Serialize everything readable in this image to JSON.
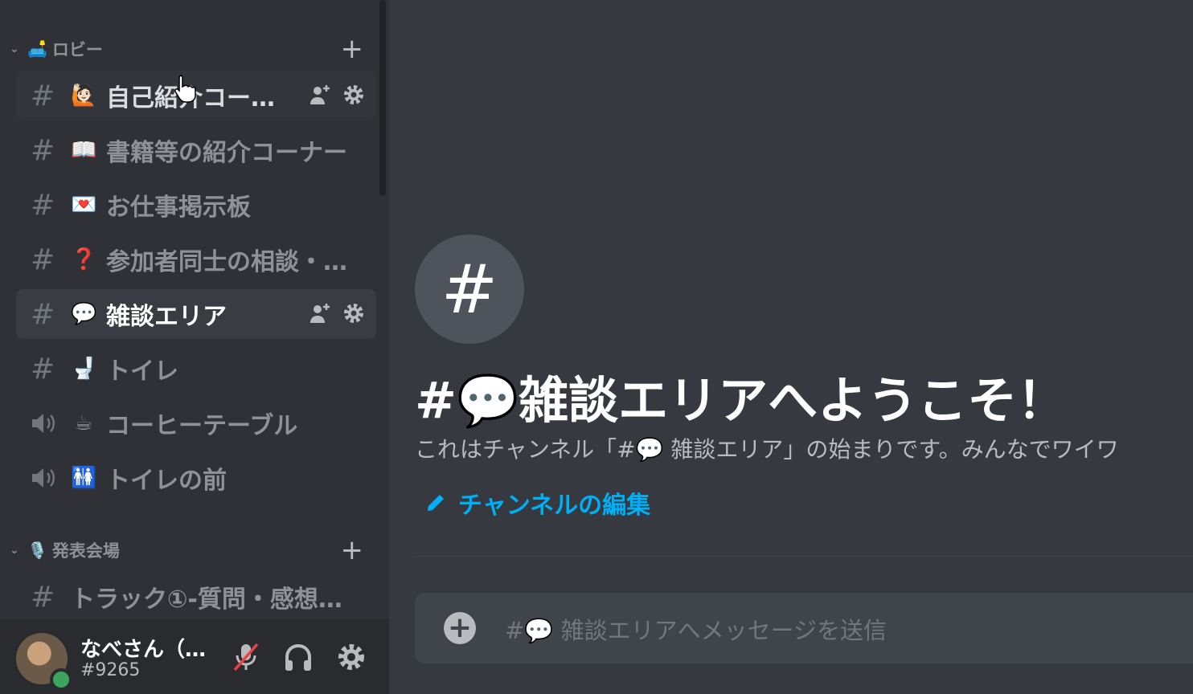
{
  "sidebar": {
    "categories": [
      {
        "emoji": "🛋️",
        "label": "ロビー"
      },
      {
        "emoji": "🎙️",
        "label": "発表会場"
      }
    ],
    "channels": [
      {
        "emoji": "🙋🏻",
        "label": "自己紹介コー…"
      },
      {
        "emoji": "📖",
        "label": "書籍等の紹介コーナー"
      },
      {
        "emoji": "💌",
        "label": "お仕事掲示板"
      },
      {
        "emoji": "❓",
        "label": "参加者同士の相談・…"
      },
      {
        "emoji": "💬",
        "label": "雑談エリア"
      },
      {
        "emoji": "🚽",
        "label": "トイレ"
      },
      {
        "emoji": "☕",
        "label": "コーヒーテーブル"
      },
      {
        "emoji": "🚻",
        "label": "トイレの前"
      },
      {
        "emoji": "",
        "label": "トラック①-質問・感想…"
      }
    ],
    "selected_channel": "雑談エリア"
  },
  "user_panel": {
    "username": "なべさん（…",
    "discriminator": "#9265",
    "status": "online"
  },
  "main": {
    "hash_symbol": "#",
    "welcome_title": "#💬雑談エリアへようこそ！",
    "welcome_description": "これはチャンネル「#💬 雑談エリア」の始まりです。みんなでワイワ",
    "edit_channel_label": "チャンネルの編集",
    "composer_placeholder": "#💬 雑談エリアへメッセージを送信"
  },
  "colors": {
    "sidebar_bg": "#2f3136",
    "main_bg": "#36393f",
    "link": "#00aff4",
    "online": "#3ba55d",
    "muted_red": "#ed4245"
  }
}
